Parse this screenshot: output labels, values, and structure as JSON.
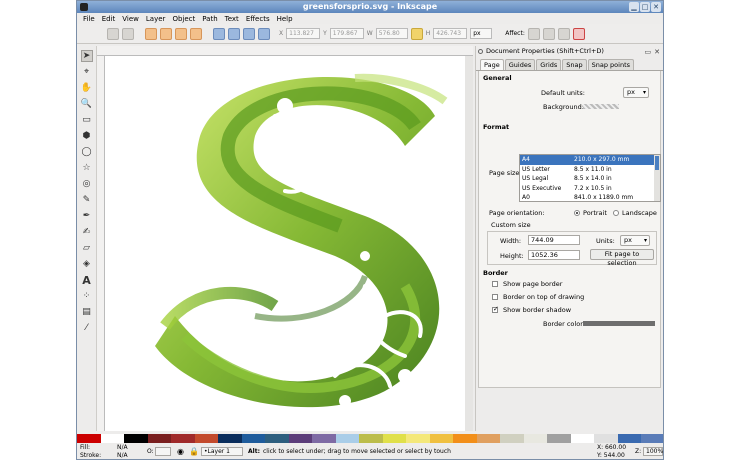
{
  "window": {
    "title": "greensforsprio.svg - Inkscape"
  },
  "menu": [
    "File",
    "Edit",
    "View",
    "Layer",
    "Object",
    "Path",
    "Text",
    "Effects",
    "Help"
  ],
  "toolbar": {
    "x": "113.827",
    "y": "179.867",
    "w": "576.80",
    "h": "426.743",
    "units": "px",
    "affect_label": "Affect:"
  },
  "panel": {
    "title": "Document Properties (Shift+Ctrl+D)",
    "tabs": [
      "Page",
      "Guides",
      "Grids",
      "Snap",
      "Snap points"
    ],
    "general": {
      "header": "General",
      "default_units_label": "Default units:",
      "default_units": "px",
      "background_label": "Background:"
    },
    "format": {
      "header": "Format",
      "page_size_label": "Page size:",
      "sizes": [
        {
          "name": "A4",
          "dims": "210.0 x 297.0 mm"
        },
        {
          "name": "US Letter",
          "dims": "8.5 x 11.0 in"
        },
        {
          "name": "US Legal",
          "dims": "8.5 x 14.0 in"
        },
        {
          "name": "US Executive",
          "dims": "7.2 x 10.5 in"
        },
        {
          "name": "A0",
          "dims": "841.0 x 1189.0 mm"
        }
      ],
      "orientation_label": "Page orientation:",
      "portrait": "Portrait",
      "landscape": "Landscape",
      "custom_size_label": "Custom size",
      "width_label": "Width:",
      "width": "744.09",
      "height_label": "Height:",
      "height": "1052.36",
      "units_label": "Units:",
      "units": "px",
      "fit_button": "Fit page to selection"
    },
    "border": {
      "header": "Border",
      "show_page_border": "Show page border",
      "border_on_top": "Border on top of drawing",
      "show_border_shadow": "Show border shadow",
      "border_color_label": "Border color:"
    }
  },
  "status": {
    "fill_label": "Fill:",
    "stroke_label": "Stroke:",
    "fill_value": "N/A",
    "stroke_value": "N/A",
    "opacity_label": "O:",
    "layer": "•Layer 1",
    "message_bold": "Alt:",
    "message": "click to select under; drag to move selected or select by touch",
    "x": "X: 660.00",
    "y": "Y: 544.00",
    "zoom_label": "Z:",
    "zoom": "100%"
  },
  "colors": {
    "palette": [
      "#cc0000",
      "#ffffff",
      "#000000",
      "#7a1f1f",
      "#a02a2a",
      "#c34a2c",
      "#0a2d5c",
      "#1f5c9c",
      "#2e5f7f",
      "#5c3d7a",
      "#7e6aa4",
      "#a9cde8",
      "#bcbd4a",
      "#e0e04a",
      "#f4e87a",
      "#f0c040",
      "#f28f1a",
      "#e0a060",
      "#d0d0c0",
      "#e8e8e0",
      "#a0a0a0",
      "#ffffff",
      "#e0e0e0",
      "#3a6ab0",
      "#5a7cb8"
    ]
  }
}
